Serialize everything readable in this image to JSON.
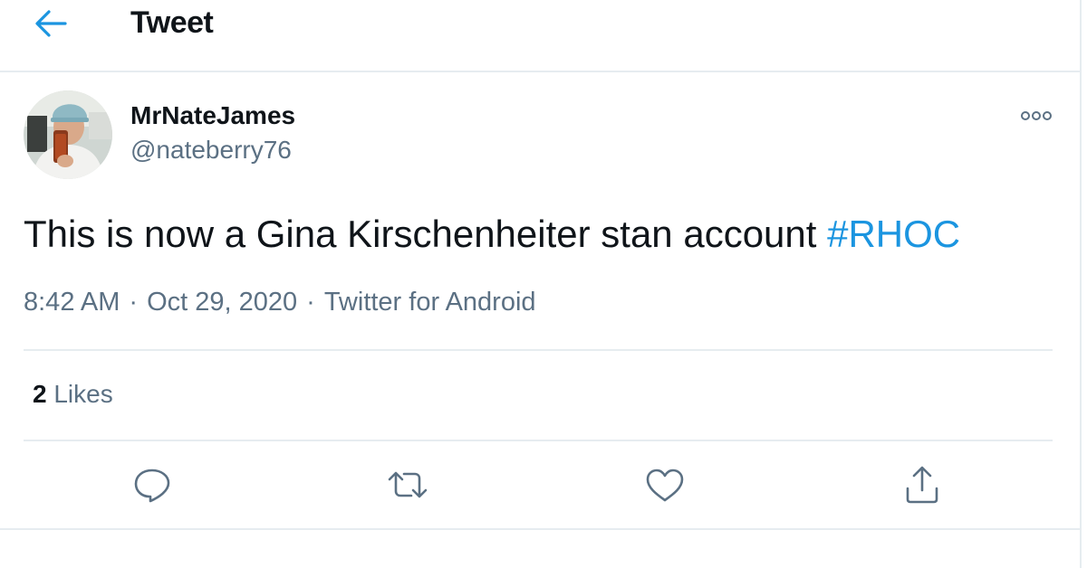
{
  "header": {
    "title": "Tweet"
  },
  "tweet": {
    "author": {
      "display_name": "MrNateJames",
      "handle": "@nateberry76"
    },
    "text": "This is now a Gina Kirschenheiter stan account",
    "hashtag": "#RHOC",
    "time": "8:42 AM",
    "separator": "·",
    "date": "Oct 29, 2020",
    "source": "Twitter for Android"
  },
  "stats": {
    "likes_count": "2",
    "likes_label": "Likes"
  },
  "icons": {
    "back": "arrow-left-icon",
    "more": "more-options-icon",
    "reply": "reply-bubble-icon",
    "retweet": "retweet-icon",
    "like": "heart-icon",
    "share": "share-icon"
  },
  "colors": {
    "accent": "#1b95e0",
    "secondary_text": "#5b7083",
    "divider": "#e6ecf0"
  }
}
